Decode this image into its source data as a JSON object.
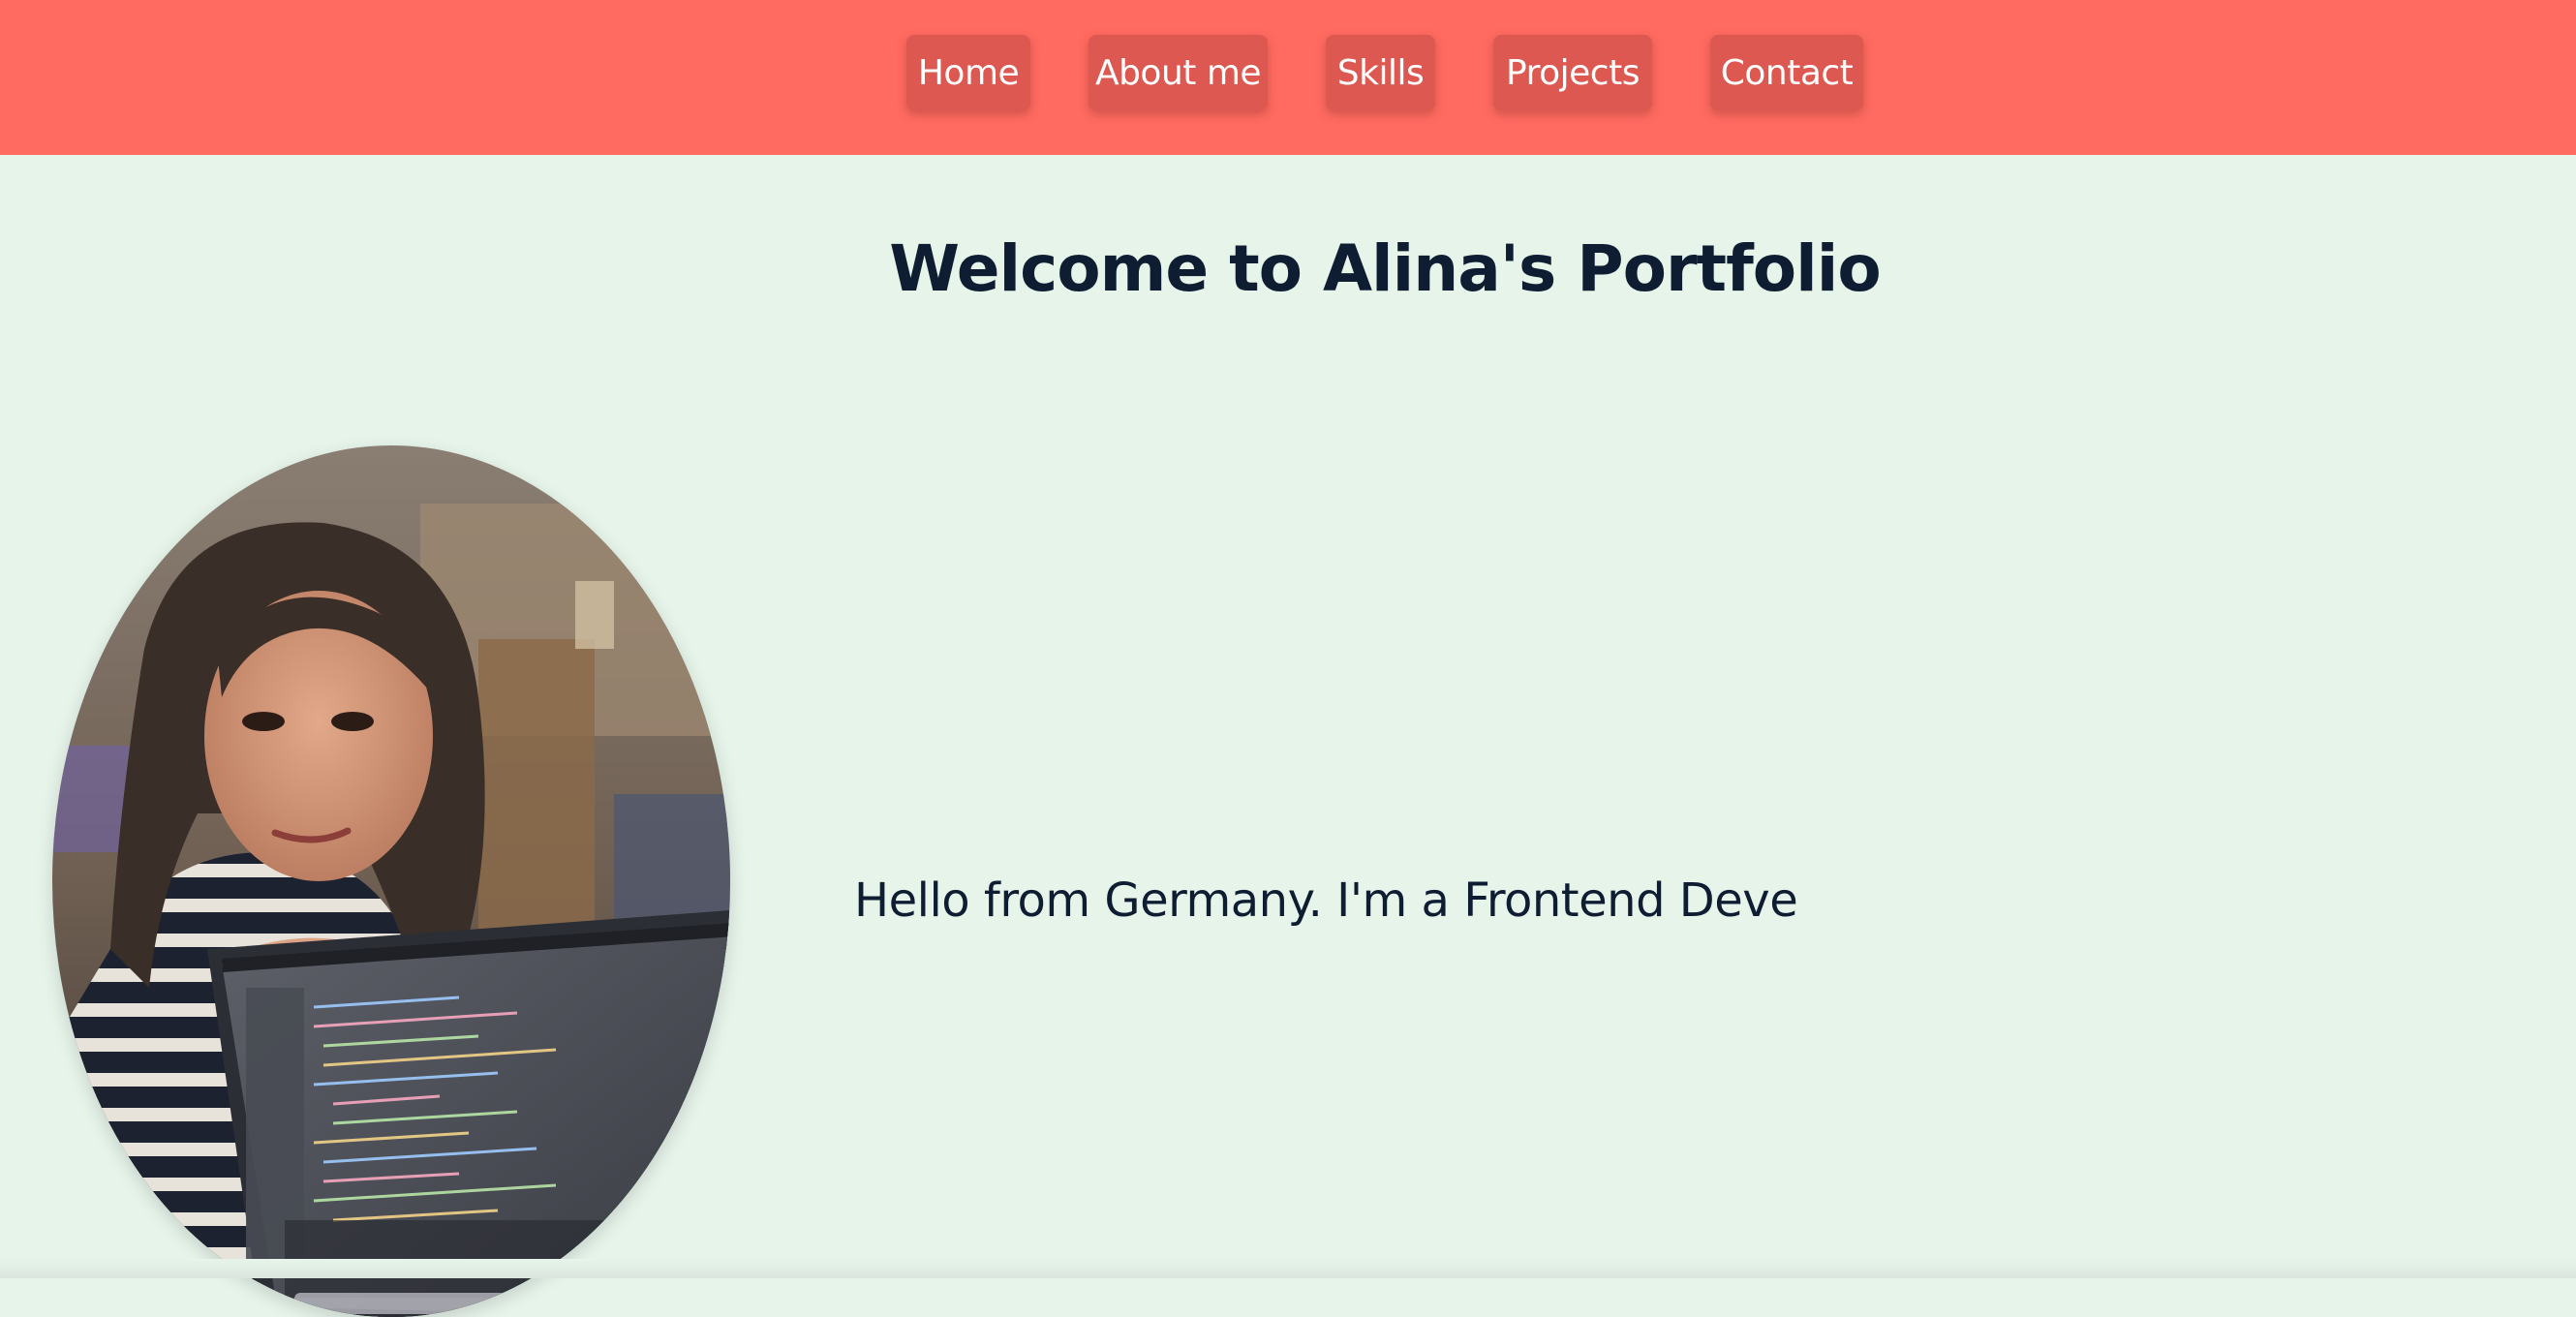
{
  "nav": {
    "items": [
      {
        "label": "Home"
      },
      {
        "label": "About me"
      },
      {
        "label": "Skills"
      },
      {
        "label": "Projects"
      },
      {
        "label": "Contact"
      }
    ]
  },
  "hero": {
    "title": "Welcome to Alina's Portfolio",
    "intro": "Hello from Germany. I'm a Frontend Deve"
  },
  "colors": {
    "navbar": "#ff6b61",
    "nav_button": "#dd5850",
    "background": "#e6f4ea",
    "text": "#0f1d33"
  }
}
